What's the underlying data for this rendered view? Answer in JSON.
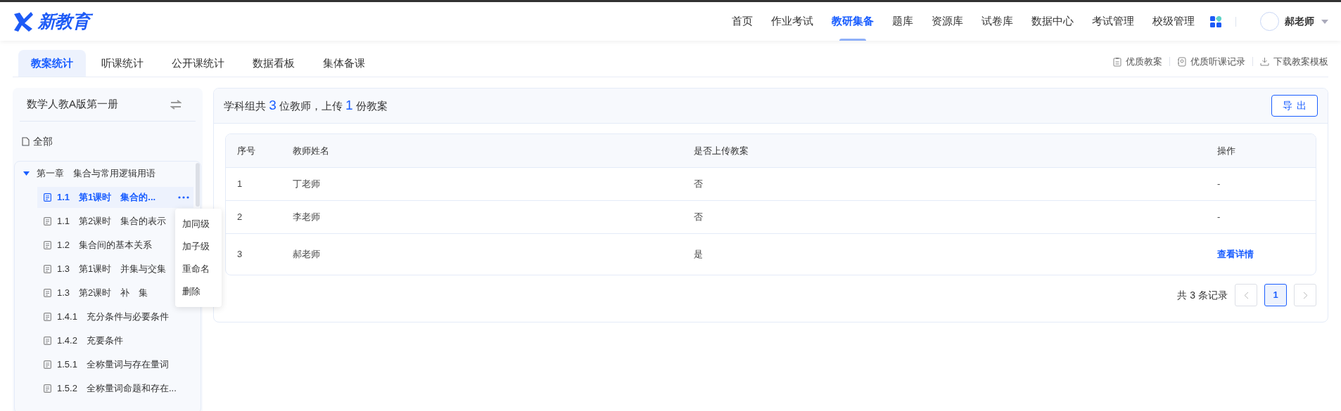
{
  "logo": {
    "text": "新教育"
  },
  "nav": [
    {
      "label": "首页",
      "selected": false
    },
    {
      "label": "作业考试",
      "selected": false
    },
    {
      "label": "教研集备",
      "selected": true
    },
    {
      "label": "题库",
      "selected": false
    },
    {
      "label": "资源库",
      "selected": false
    },
    {
      "label": "试卷库",
      "selected": false
    },
    {
      "label": "数据中心",
      "selected": false
    },
    {
      "label": "考试管理",
      "selected": false
    },
    {
      "label": "校级管理",
      "selected": false
    }
  ],
  "user": {
    "name": "郝老师"
  },
  "subtabs": [
    {
      "label": "教案统计",
      "selected": true
    },
    {
      "label": "听课统计",
      "selected": false
    },
    {
      "label": "公开课统计",
      "selected": false
    },
    {
      "label": "数据看板",
      "selected": false
    },
    {
      "label": "集体备课",
      "selected": false
    }
  ],
  "links": [
    {
      "label": "优质教案",
      "kind": "clipboard"
    },
    {
      "label": "优质听课记录",
      "kind": "record"
    },
    {
      "label": "下载教案模板",
      "kind": "download"
    }
  ],
  "sidebar": {
    "book": "数学人教A版第一册",
    "all": "全部",
    "tree": [
      {
        "label": "第一章　集合与常用逻辑用语",
        "expanded": true,
        "children": [
          {
            "label": "1.1　第1课时　集合的...",
            "selected": true
          },
          {
            "label": "1.1　第2课时　集合的表示",
            "selected": false
          },
          {
            "label": "1.2　集合间的基本关系",
            "selected": false
          },
          {
            "label": "1.3　第1课时　并集与交集",
            "selected": false
          },
          {
            "label": "1.3　第2课时　补　集",
            "selected": false
          },
          {
            "label": "1.4.1　充分条件与必要条件",
            "selected": false
          },
          {
            "label": "1.4.2　充要条件",
            "selected": false
          },
          {
            "label": "1.5.1　全称量词与存在量词",
            "selected": false
          },
          {
            "label": "1.5.2　全称量词命题和存在...",
            "selected": false
          }
        ]
      }
    ],
    "context_menu": [
      "加同级",
      "加子级",
      "重命名",
      "删除"
    ]
  },
  "summary": [
    {
      "text": "学科组共 ",
      "kind": "plain"
    },
    {
      "text": "3",
      "kind": "count"
    },
    {
      "text": " 位教师，上传 ",
      "kind": "plain"
    },
    {
      "text": "1",
      "kind": "count"
    },
    {
      "text": " 份教案",
      "kind": "plain"
    }
  ],
  "export_button": "导出",
  "table": {
    "columns": [
      "序号",
      "教师姓名",
      "是否上传教案",
      "操作"
    ],
    "rows": [
      {
        "cells": [
          "1",
          "丁老师",
          "否"
        ],
        "action": {
          "text": "-",
          "kind": "none"
        }
      },
      {
        "cells": [
          "2",
          "李老师",
          "否"
        ],
        "action": {
          "text": "-",
          "kind": "none"
        }
      },
      {
        "cells": [
          "3",
          "郝老师",
          "是"
        ],
        "action": {
          "text": "查看详情",
          "kind": "link"
        }
      }
    ]
  },
  "pagination": {
    "total": "共 3 条记录",
    "pages": [
      {
        "label": "1",
        "selected": true
      }
    ]
  }
}
